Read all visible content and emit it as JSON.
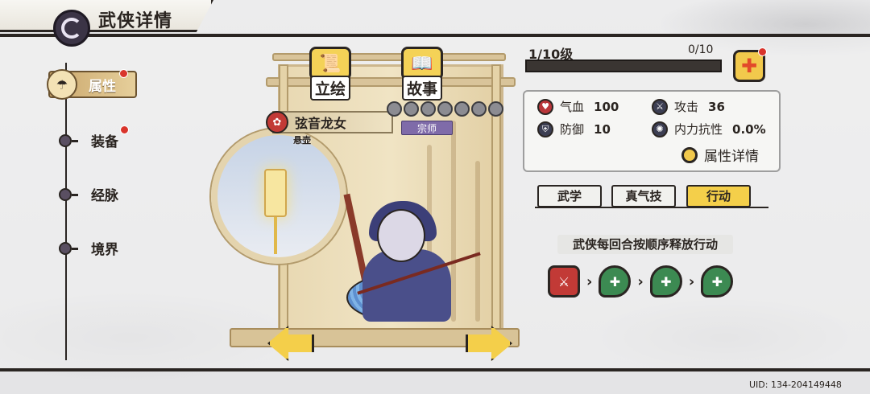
{
  "header": {
    "title": "武侠详情"
  },
  "sidebar": {
    "items": [
      {
        "label": "属性",
        "active": true,
        "badge": true
      },
      {
        "label": "装备",
        "active": false,
        "badge": true
      },
      {
        "label": "经脉",
        "active": false,
        "badge": false
      },
      {
        "label": "境界",
        "active": false,
        "badge": false
      }
    ]
  },
  "scene": {
    "tabs": [
      {
        "label": "立绘"
      },
      {
        "label": "故事"
      }
    ],
    "hero_name": "弦音龙女",
    "hero_subtitle": "悬壶",
    "rank": "宗师",
    "stars": 7
  },
  "level": {
    "text": "1/10级",
    "exp": "0/10",
    "fill": 0.0
  },
  "stats": {
    "hp_label": "气血",
    "hp": "100",
    "atk_label": "攻击",
    "atk": "36",
    "def_label": "防御",
    "def": "10",
    "res_label": "内力抗性",
    "res": "0.0%",
    "detail_link": "属性详情"
  },
  "tabs": [
    {
      "label": "武学"
    },
    {
      "label": "真气技"
    },
    {
      "label": "行动"
    }
  ],
  "action": {
    "title": "武侠每回合按顺序释放行动",
    "sequence": [
      "sword",
      "heal",
      "heal",
      "heal"
    ]
  },
  "uid": "UID: 134-204149448",
  "colors": {
    "accent": "#f4cf4a",
    "dark": "#2a2522",
    "badge": "#d9342b",
    "rank": "#7f6ba9"
  }
}
